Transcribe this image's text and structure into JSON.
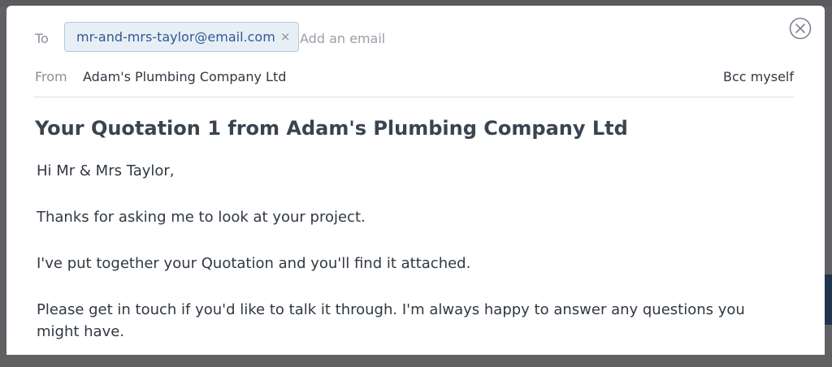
{
  "compose": {
    "to_label": "To",
    "recipients": [
      {
        "email": "mr-and-mrs-taylor@email.com",
        "remove": "×"
      }
    ],
    "add_email_placeholder": "Add an email",
    "from_label": "From",
    "from_value": "Adam's Plumbing Company Ltd",
    "bcc_label": "Bcc myself",
    "close_icon": "close-circle-icon",
    "subject": "Your Quotation 1 from Adam's Plumbing Company Ltd",
    "body": [
      "Hi Mr & Mrs Taylor,",
      "Thanks for asking me to look at your project.",
      "I've put together your Quotation and you'll find it attached.",
      "Please get in touch if you'd like to talk it through. I'm always happy to answer any questions you might have."
    ]
  },
  "colors": {
    "chip_bg": "#e8eef6",
    "chip_text": "#2d5b91",
    "subject_text": "#3a4451",
    "overlay": "#606164"
  }
}
